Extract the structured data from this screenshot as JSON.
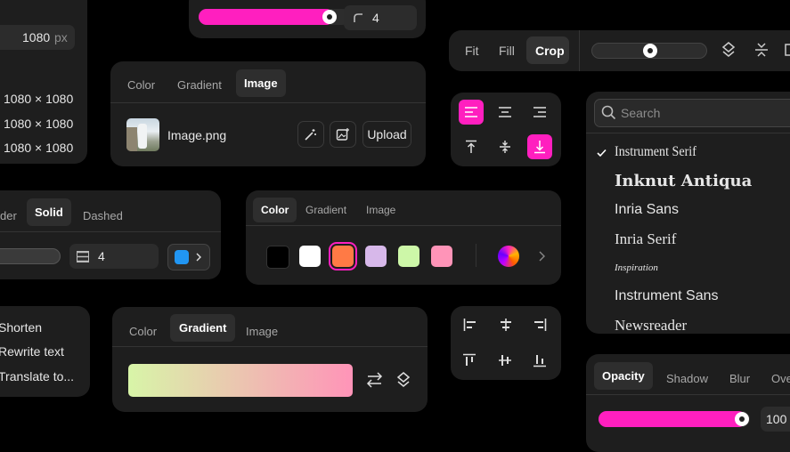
{
  "size_panel": {
    "value": "1080",
    "unit": "px",
    "presets": [
      "1080 × 1080",
      "1080 × 1080",
      "1080 × 1080"
    ]
  },
  "top_slider": {
    "level": 0.97,
    "radius_value": "4"
  },
  "fit_toolbar": {
    "fit": "Fit",
    "fill": "Fill",
    "crop": "Crop",
    "level": 0.5
  },
  "image_fill": {
    "tabs": [
      "Color",
      "Gradient",
      "Image"
    ],
    "active_tab": "Image",
    "file_name": "Image.png",
    "upload_label": "Upload"
  },
  "align_grid": {
    "active": [
      "align-left",
      "align-bottom"
    ]
  },
  "font_list": {
    "search_placeholder": "Search",
    "fonts": [
      "Instrument Serif",
      "Inknut Antiqua",
      "Inria Sans",
      "Inria Serif",
      "Inspiration",
      "Instrument Sans",
      "Newsreader"
    ],
    "selected": "Instrument Serif"
  },
  "stroke_panel": {
    "tabs": [
      "der",
      "Solid",
      "Dashed"
    ],
    "active_tab": "Solid",
    "width_value": "4",
    "color": "#2196f3"
  },
  "color_fill": {
    "tabs": [
      "Color",
      "Gradient",
      "Image"
    ],
    "active_tab": "Color",
    "swatches": [
      "#000000",
      "#ffffff",
      "#ff7a45",
      "#d7b8ea",
      "#cdf7a8",
      "#ff94b8"
    ],
    "selected_swatch": "#ff7a45"
  },
  "ai_menu": {
    "items": [
      "Shorten",
      "Rewrite text",
      "Translate to..."
    ]
  },
  "gradient_fill": {
    "tabs": [
      "Color",
      "Gradient",
      "Image"
    ],
    "active_tab": "Gradient",
    "gradient_start": "#d8f5a8",
    "gradient_end": "#ff94b8"
  },
  "effects_panel": {
    "tabs": [
      "Opacity",
      "Shadow",
      "Blur",
      "Ove"
    ],
    "active_tab": "Opacity",
    "opacity_value": "100",
    "level": 1.0
  },
  "colors": {
    "accent": "#ff1fbf",
    "panel": "#1e1e1e",
    "background": "#000000"
  }
}
